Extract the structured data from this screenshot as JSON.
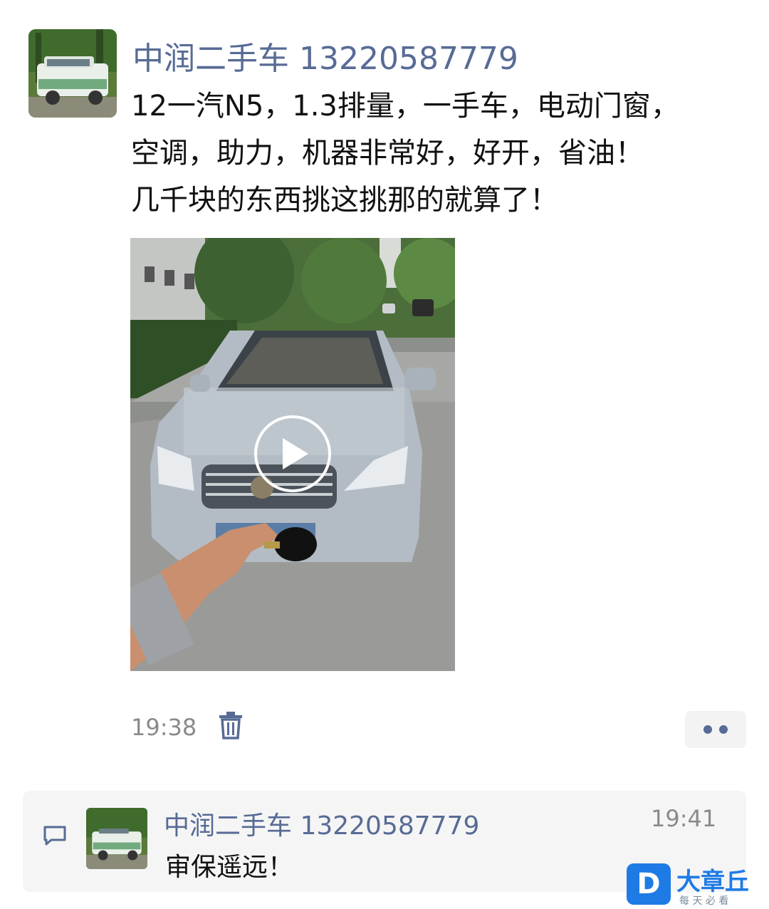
{
  "post": {
    "author": "中润二手车 13220587779",
    "avatar_icon": "car-avatar-icon",
    "text_lines": [
      "12一汽N5，1.3排量，一手车，电动门窗，",
      "空调，助力，机器非常好，好开，省油！",
      "几千块的东西挑这挑那的就算了！"
    ],
    "video": {
      "play_icon": "play-icon"
    },
    "time": "19:38",
    "delete_icon": "trash-icon",
    "more_icon": "more-dots-icon"
  },
  "comments": {
    "section_icon": "comment-icon",
    "items": [
      {
        "author": "中润二手车 13220587779",
        "time": "19:41",
        "text": "审保遥远！"
      }
    ]
  },
  "watermark": {
    "logo_letter": "D",
    "brand": "大章丘",
    "tagline": "每 天 必 看"
  },
  "colors": {
    "author_link": "#576b95",
    "brand_blue": "#1e7be6"
  }
}
